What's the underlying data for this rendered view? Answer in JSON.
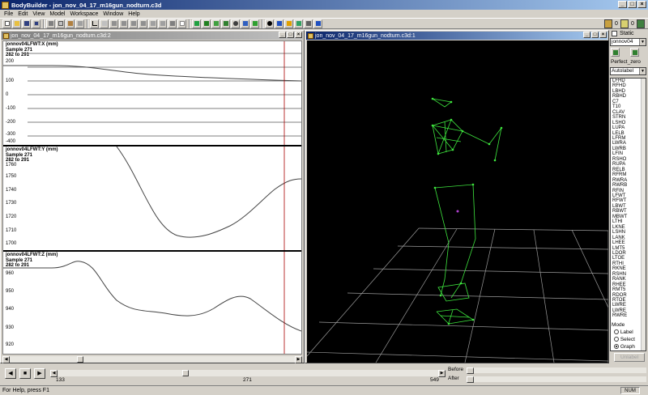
{
  "app": {
    "title": "BodyBuilder - jon_nov_04_17_m16gun_nodturn.c3d",
    "indicators": {
      "left_value": "0",
      "right_value": "0"
    }
  },
  "menu": [
    "File",
    "Edit",
    "View",
    "Model",
    "Workspace",
    "Window",
    "Help"
  ],
  "graph_window": {
    "title": "jon_nov_04_17_m16gun_nodturn.c3d:2",
    "panels": [
      {
        "channel": "jonnov04LFWT:X (mm)",
        "sample": "Sample 271",
        "range": "282 to 291",
        "y_ticks": [
          "200",
          "100",
          "0",
          "-100",
          "-200",
          "-300",
          "-400"
        ]
      },
      {
        "channel": "jonnov04LFWT:Y (mm)",
        "sample": "Sample 271",
        "range": "282 to 291",
        "y_ticks": [
          "1760",
          "1750",
          "1740",
          "1730",
          "1720",
          "1710",
          "1700"
        ]
      },
      {
        "channel": "jonnov04LFWT:Z (mm)",
        "sample": "Sample 271",
        "range": "282 to 291",
        "y_ticks": [
          "960",
          "950",
          "940",
          "930",
          "920"
        ]
      }
    ]
  },
  "view_window": {
    "title": "jon_nov_04_17_m16gun_nodturn.c3d:1"
  },
  "right_panel": {
    "static_label": "Static",
    "subject": "jonnov04",
    "model": "Perfect_zero",
    "mode_select": "Autolabel",
    "labels": [
      "LFHD",
      "RFHD",
      "LBHD",
      "RBHD",
      "C7",
      "T10",
      "CLAV",
      "STRN",
      "LSHO",
      "LUPA",
      "LELB",
      "LFRM",
      "LWRA",
      "LWRB",
      "LFIN",
      "RSHO",
      "RUPA",
      "RELB",
      "RFRM",
      "RWRA",
      "RWRB",
      "RFIN",
      "LFWT",
      "RFWT",
      "LBWT",
      "RBWT",
      "MBWT",
      "LTHI",
      "LKNE",
      "LSHN",
      "LANK",
      "LHEE",
      "LMT5",
      "LDOR",
      "LTOE",
      "RTHI",
      "RKNE",
      "RSHN",
      "RANK",
      "RHEE",
      "RMT5",
      "RDOR",
      "RTOE",
      "LWRE",
      "LWRE",
      "RWRE"
    ],
    "mode_title": "Mode",
    "mode_options": [
      "Label",
      "Select",
      "Graph"
    ],
    "mode_selected": "Graph",
    "unlabel_button": "Unlabel"
  },
  "playback": {
    "start_frame": "133",
    "current_frame": "271",
    "end_frame": "549",
    "before_label": "Before",
    "after_label": "After"
  },
  "status": {
    "text": "For Help, press F1",
    "num": "NUM"
  }
}
